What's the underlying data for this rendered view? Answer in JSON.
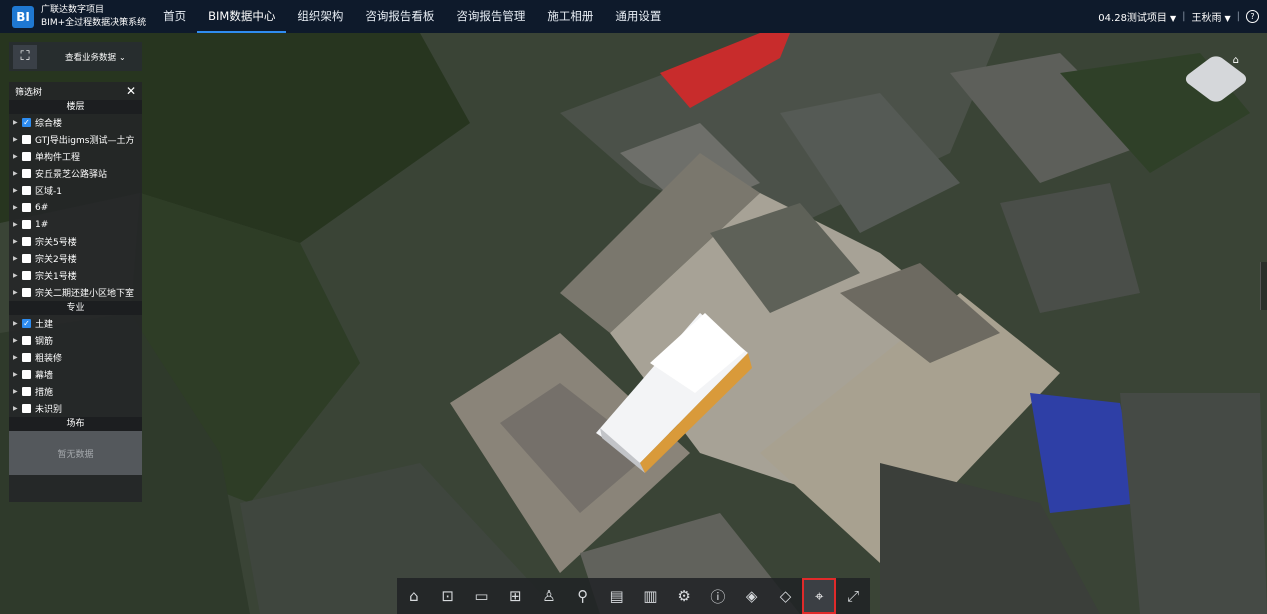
{
  "app": {
    "logo_text": "BI",
    "brand_line1": "广联达数字项目",
    "brand_line2": "BIM+全过程数据决策系统"
  },
  "nav": [
    "首页",
    "BIM数据中心",
    "组织架构",
    "咨询报告看板",
    "咨询报告管理",
    "施工相册",
    "通用设置"
  ],
  "nav_active": "BIM数据中心",
  "topright": {
    "project": "04.28测试项目",
    "user": "王秋雨",
    "help_icon": "question-circle-icon"
  },
  "org_button": {
    "icon": "org-tree-icon",
    "label": "查看业务数据"
  },
  "filter": {
    "title": "筛选树",
    "sections": {
      "floors": "楼层",
      "disciplines": "专业",
      "site": "场布"
    },
    "floors": [
      {
        "label": "综合楼",
        "checked": true
      },
      {
        "label": "GTJ导出igms测试—土方",
        "checked": false
      },
      {
        "label": "单构件工程",
        "checked": false
      },
      {
        "label": "安丘景芝公路驿站",
        "checked": false
      },
      {
        "label": "区域-1",
        "checked": false
      },
      {
        "label": "6#",
        "checked": false
      },
      {
        "label": "1#",
        "checked": false
      },
      {
        "label": "宗关5号楼",
        "checked": false
      },
      {
        "label": "宗关2号楼",
        "checked": false
      },
      {
        "label": "宗关1号楼",
        "checked": false
      },
      {
        "label": "宗关二期还建小区地下室",
        "checked": false
      }
    ],
    "disciplines": [
      {
        "label": "土建",
        "checked": true
      },
      {
        "label": "钢筋",
        "checked": false
      },
      {
        "label": "粗装修",
        "checked": false
      },
      {
        "label": "幕墙",
        "checked": false
      },
      {
        "label": "措施",
        "checked": false
      },
      {
        "label": "未识别",
        "checked": false
      }
    ],
    "empty_text": "暂无数据"
  },
  "toolbar_icons": [
    "home-icon",
    "zoom-box-icon",
    "measure-icon",
    "section-icon",
    "person-walk-icon",
    "location-pin-icon",
    "list-icon",
    "chart-icon",
    "settings-icon",
    "info-icon",
    "model-cube-icon",
    "box-icon",
    "map-marker-icon",
    "fullscreen-icon"
  ],
  "toolbar_glyphs": [
    "⌂",
    "⊡",
    "▭",
    "⊞",
    "♙",
    "⚲",
    "▤",
    "▥",
    "⚙",
    "ⓘ",
    "◈",
    "◇",
    "⌖",
    "⤢"
  ],
  "toolbar_active": "map-marker-icon"
}
